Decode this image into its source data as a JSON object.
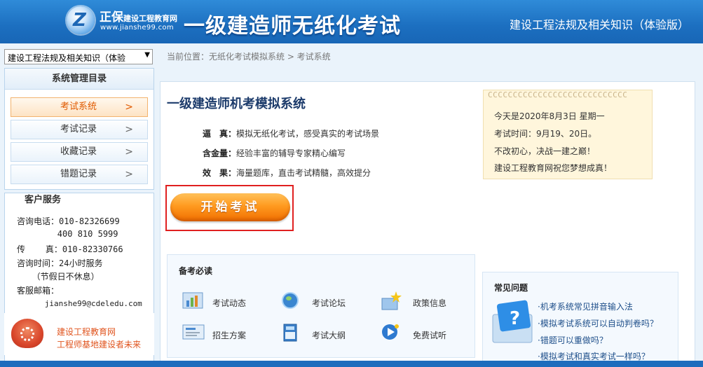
{
  "header": {
    "logo_name": "正保",
    "logo_name_small": "建设工程教育网",
    "logo_url": "www.jianshe99.com",
    "main_title": "一级建造师无纸化考试",
    "subject_title": "建设工程法规及相关知识（体验版）"
  },
  "subject_select": {
    "value": "建设工程法规及相关知识（体验"
  },
  "nav": {
    "heading": "系统管理目录",
    "items": [
      {
        "label": "考试系统"
      },
      {
        "label": "考试记录"
      },
      {
        "label": "收藏记录"
      },
      {
        "label": "错题记录"
      }
    ]
  },
  "service": {
    "heading": "客户服务",
    "lines": [
      "咨询电话：010-82326699",
      "        400 810 5999",
      "传    真：010-82330766",
      "咨询时间：24小时服务",
      "   （节假日不休息）",
      "客服邮箱：",
      "      jianshe99@cdeledu.com"
    ]
  },
  "promo": {
    "line1": "建设工程教育网",
    "line2": "工程师基地建设者未来"
  },
  "breadcrumb": "当前位置：无纸化考试模拟系统 > 考试系统",
  "system": {
    "title": "一级建造师机考模拟系统",
    "features": [
      {
        "key": "逼　真：",
        "value": "模拟无纸化考试，感受真实的考试场景"
      },
      {
        "key": "含金量：",
        "value": "经验丰富的辅导专家精心编写"
      },
      {
        "key": "效　果：",
        "value": "海量题库，直击考试精髓，高效提分"
      }
    ],
    "start_label": "开始考试"
  },
  "note": {
    "rings": "CCCCCCCCCCCCCCCCCCCCCCCCCCCC",
    "lines": [
      "今天是2020年8月3日 星期一",
      "考试时间：9月19、20日。",
      "不改初心，决战一建之巅！",
      "建设工程教育网祝您梦想成真！"
    ]
  },
  "prep": {
    "title": "备考必读",
    "items": [
      {
        "label": "考试动态",
        "icon": "chart-icon"
      },
      {
        "label": "考试论坛",
        "icon": "globe-icon"
      },
      {
        "label": "政策信息",
        "icon": "star-icon"
      },
      {
        "label": "招生方案",
        "icon": "screen-icon"
      },
      {
        "label": "考试大纲",
        "icon": "book-icon"
      },
      {
        "label": "免费试听",
        "icon": "media-icon"
      }
    ]
  },
  "faq": {
    "title": "常见问题",
    "items": [
      "·机考系统常见拼音输入法",
      "·模拟考试系统可以自动判卷吗？",
      "·错题可以重做吗？",
      "·模拟考试和真实考试一样吗？"
    ]
  },
  "colors": {
    "brand_blue": "#1c6fc0",
    "accent_orange": "#f06e00",
    "highlight_red": "#e02020"
  }
}
